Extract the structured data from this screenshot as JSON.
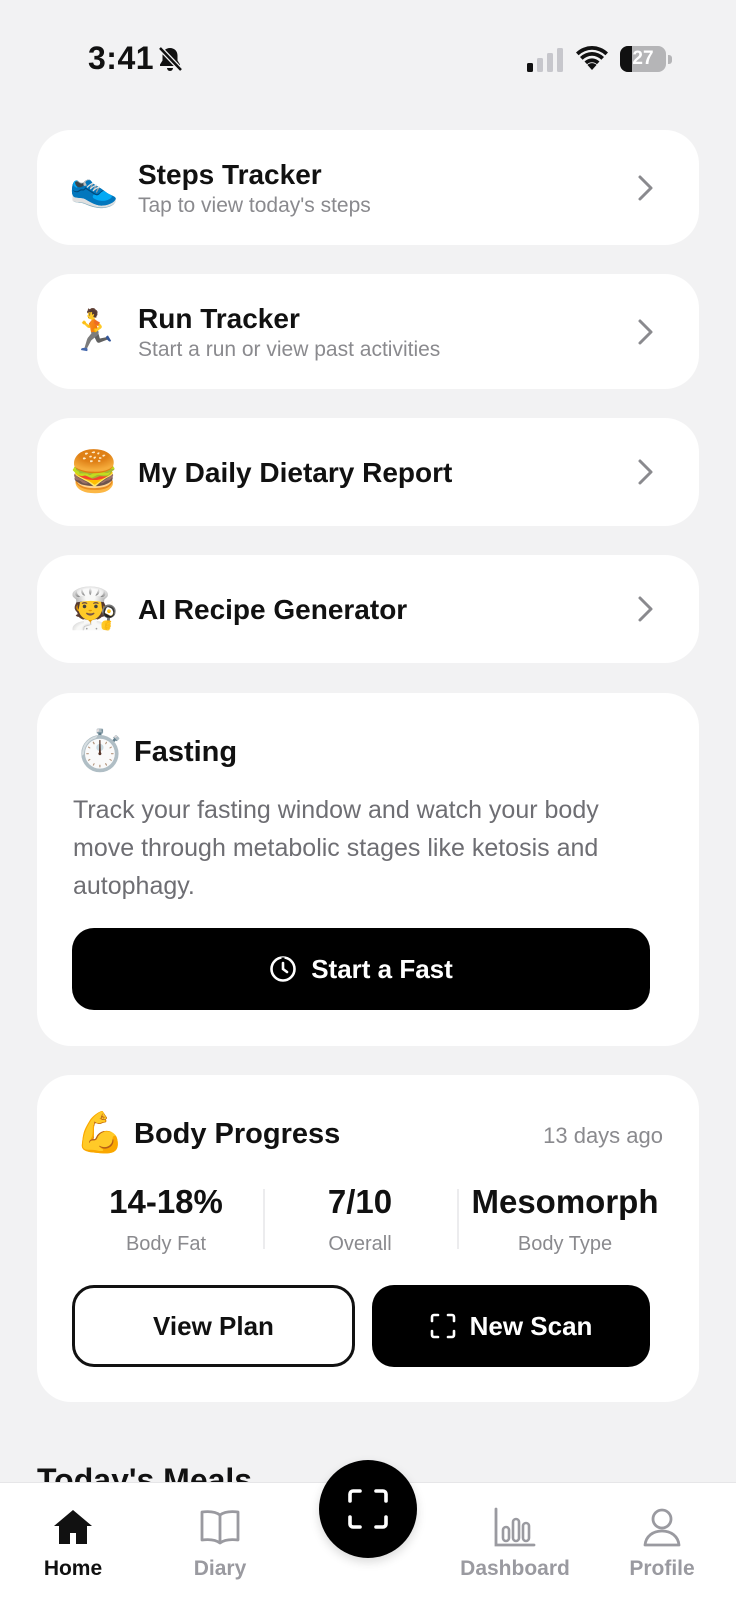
{
  "status_bar": {
    "time": "3:41",
    "battery": "27",
    "battery_level": 0.27
  },
  "cards": [
    {
      "emoji": "👟",
      "title": "Steps Tracker",
      "subtitle": "Tap to view today's steps"
    },
    {
      "emoji": "🏃",
      "title": "Run Tracker",
      "subtitle": "Start a run or view past activities"
    },
    {
      "emoji": "🍔",
      "title": "My Daily Dietary Report"
    },
    {
      "emoji": "🧑‍🍳",
      "title": "AI Recipe Generator"
    }
  ],
  "fasting": {
    "emoji": "⏱️",
    "title": "Fasting",
    "description": "Track your fasting window and watch your body move through metabolic stages like ketosis and autophagy.",
    "button_label": "Start a Fast"
  },
  "body_progress": {
    "emoji": "💪",
    "title": "Body Progress",
    "updated": "13 days ago",
    "stats": [
      {
        "value": "14-18%",
        "label": "Body Fat"
      },
      {
        "value": "7/10",
        "label": "Overall"
      },
      {
        "value": "Mesomorph",
        "label": "Body Type"
      }
    ],
    "view_plan_label": "View Plan",
    "new_scan_label": "New Scan"
  },
  "todays_meals_heading": "Today's Meals",
  "tab_bar": {
    "tabs": [
      {
        "label": "Home",
        "icon": "home-icon",
        "active": true
      },
      {
        "label": "Diary",
        "icon": "book-icon",
        "active": false
      },
      {
        "label": "Dashboard",
        "icon": "bar-chart-icon",
        "active": false
      },
      {
        "label": "Profile",
        "icon": "person-icon",
        "active": false
      }
    ],
    "center_icon": "scan-icon"
  }
}
